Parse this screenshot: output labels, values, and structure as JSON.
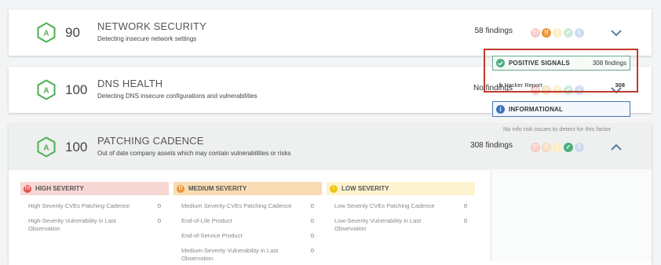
{
  "categories": [
    {
      "grade": "A",
      "score": "90",
      "title": "NETWORK SECURITY",
      "description": "Detecting insecure network settings",
      "findings": "58 findings",
      "expanded": false,
      "dots": [
        "pale-red",
        "orange",
        "pale-yellow",
        "pale-green",
        "pale-blue"
      ]
    },
    {
      "grade": "A",
      "score": "100",
      "title": "DNS HEALTH",
      "description": "Detecting DNS insecure configurations and vulnerabilities",
      "findings": "No findings",
      "expanded": false,
      "dots": [
        "pale-red",
        "pale-orange",
        "pale-yellow",
        "pale-green",
        "pale-blue"
      ]
    },
    {
      "grade": "A",
      "score": "100",
      "title": "PATCHING CADENCE",
      "description": "Out of date company assets which may contain vulnerabilities or risks",
      "findings": "308 findings",
      "expanded": true,
      "dots": [
        "pale-red",
        "pale-orange",
        "pale-yellow",
        "green",
        "pale-blue"
      ]
    }
  ],
  "severity": {
    "high": {
      "label": "HIGH SEVERITY",
      "items": [
        {
          "name": "High Severity CVEs Patching Cadence",
          "count": "0"
        },
        {
          "name": "High-Severity Vulnerability in Last Observation",
          "count": "0"
        }
      ]
    },
    "medium": {
      "label": "MEDIUM SEVERITY",
      "items": [
        {
          "name": "Medium Severity CVEs Patching Cadence",
          "count": "0"
        },
        {
          "name": "End-of-Life Product",
          "count": "0"
        },
        {
          "name": "End-of-Service Product",
          "count": "0"
        },
        {
          "name": "Medium-Severity Vulnerability in Last Observation",
          "count": "0"
        }
      ]
    },
    "low": {
      "label": "LOW SEVERITY",
      "items": [
        {
          "name": "Low Severity CVEs Patching Cadence",
          "count": "0"
        },
        {
          "name": "Low-Severity Vulnerability in Last Observation",
          "count": "0"
        }
      ]
    }
  },
  "positive_signals": {
    "label": "POSITIVE SIGNALS",
    "findings": "308 findings",
    "item_name": "Hacker Report",
    "item_value": "308"
  },
  "informational": {
    "label": "INFORMATIONAL",
    "message": "No info risk issues to detect for this factor"
  },
  "colors": {
    "grade_green": "#4caf50",
    "high": "#f7d7d4",
    "high_icon": "#d9534f",
    "medium": "#f9dcb3",
    "medium_icon": "#e8963a",
    "low": "#fdf3cf",
    "low_icon": "#f1c40f",
    "positive": "#4caf7d",
    "info": "#3e72c4",
    "highlight": "#c0392b"
  }
}
